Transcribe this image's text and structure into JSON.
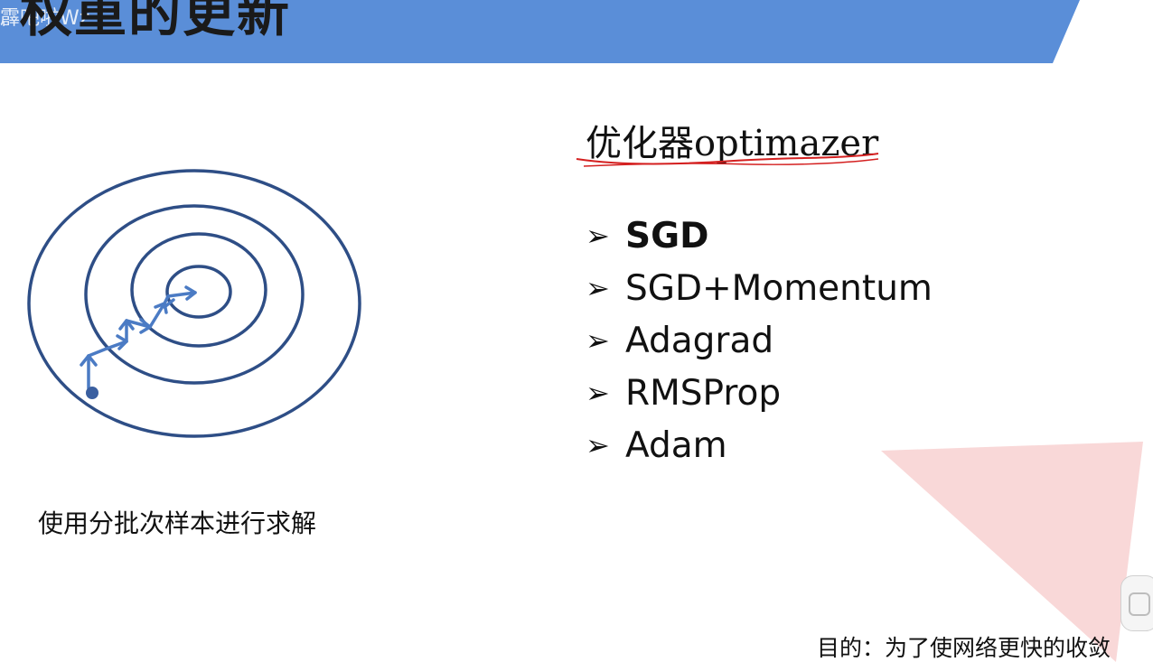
{
  "header": {
    "title": "权重的更新",
    "watermark": "霹吧啦Wz",
    "banner_color": "#5a8ed8"
  },
  "diagram": {
    "description_icon": "contour-descent-icon",
    "ring_color": "#2e4e86",
    "arrow_color": "#4b7bc4"
  },
  "caption": "使用分批次样本进行求解",
  "optimizer": {
    "title": "优化器optimazer",
    "underline_color": "#d42020",
    "items": [
      {
        "label": "SGD",
        "bold": true
      },
      {
        "label": "SGD+Momentum",
        "bold": false
      },
      {
        "label": "Adagrad",
        "bold": false
      },
      {
        "label": "RMSProp",
        "bold": false
      },
      {
        "label": "Adam",
        "bold": false
      }
    ],
    "bullet_icon": "arrow-bullet-icon"
  },
  "footer": {
    "purpose": "目的：为了使网络更快的收敛"
  },
  "decor": {
    "triangle_color": "#f9d8d8"
  }
}
